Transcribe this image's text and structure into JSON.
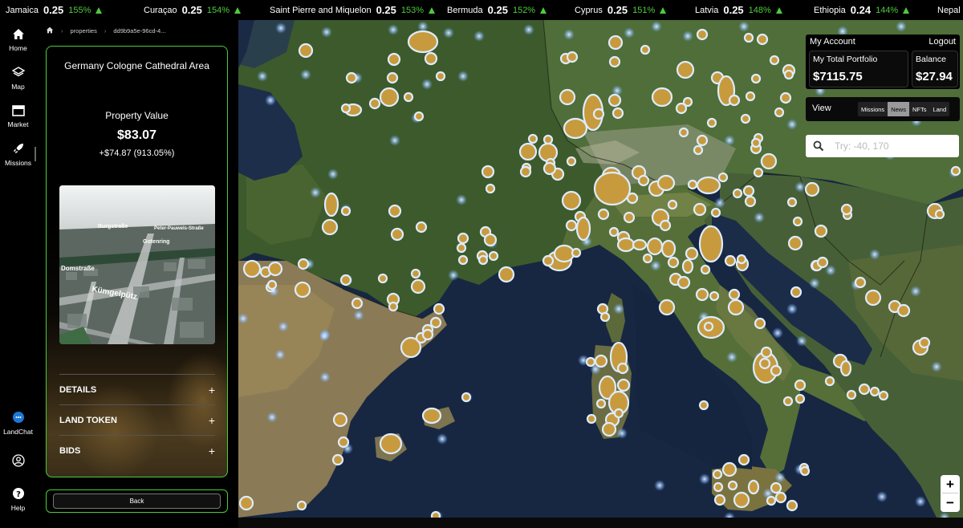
{
  "ticker": [
    {
      "name": "Jamaica",
      "price": "0.25",
      "pct": "155%"
    },
    {
      "name": "Curaçao",
      "price": "0.25",
      "pct": "154%"
    },
    {
      "name": "Saint Pierre and Miquelon",
      "price": "0.25",
      "pct": "153%"
    },
    {
      "name": "Bermuda",
      "price": "0.25",
      "pct": "152%"
    },
    {
      "name": "Cyprus",
      "price": "0.25",
      "pct": "151%"
    },
    {
      "name": "Latvia",
      "price": "0.25",
      "pct": "148%"
    },
    {
      "name": "Ethiopia",
      "price": "0.24",
      "pct": "144%"
    },
    {
      "name": "Nepal",
      "price": "",
      "pct": ""
    }
  ],
  "nav": {
    "home": "Home",
    "map": "Map",
    "market": "Market",
    "missions": "Missions",
    "landchat": "LandChat",
    "help": "Help"
  },
  "breadcrumb": {
    "properties": "properties",
    "id": "dd9b9a5e-96cd-4..."
  },
  "property": {
    "title": "Germany Cologne Cathedral Area",
    "value_label": "Property Value",
    "value": "$83.07",
    "change": "+$74.87 (913.05%)",
    "image_labels": [
      "Burgstraße",
      "Peter-Pauwels-Straße",
      "Gotenring",
      "Domstraße",
      "Kümgelpütz"
    ],
    "sections": [
      {
        "label": "DETAILS"
      },
      {
        "label": "LAND TOKEN"
      },
      {
        "label": "BIDS"
      }
    ],
    "back_label": "Back"
  },
  "account": {
    "heading": "My Account",
    "logout": "Logout",
    "portfolio_label": "My Total Portfolio",
    "portfolio_value": "$7115.75",
    "balance_label": "Balance",
    "balance_value": "$27.94"
  },
  "view": {
    "label": "View",
    "options": [
      "Missions",
      "News",
      "NFTs",
      "Land"
    ],
    "selected": "News"
  },
  "search": {
    "placeholder": "Try: -40, 170"
  },
  "zoom": {
    "in": "+",
    "out": "−"
  },
  "colors": {
    "accent_green": "#4ecb3c",
    "marker_fill": "#c89a3e",
    "marker_glow": "#cfe4ff"
  }
}
